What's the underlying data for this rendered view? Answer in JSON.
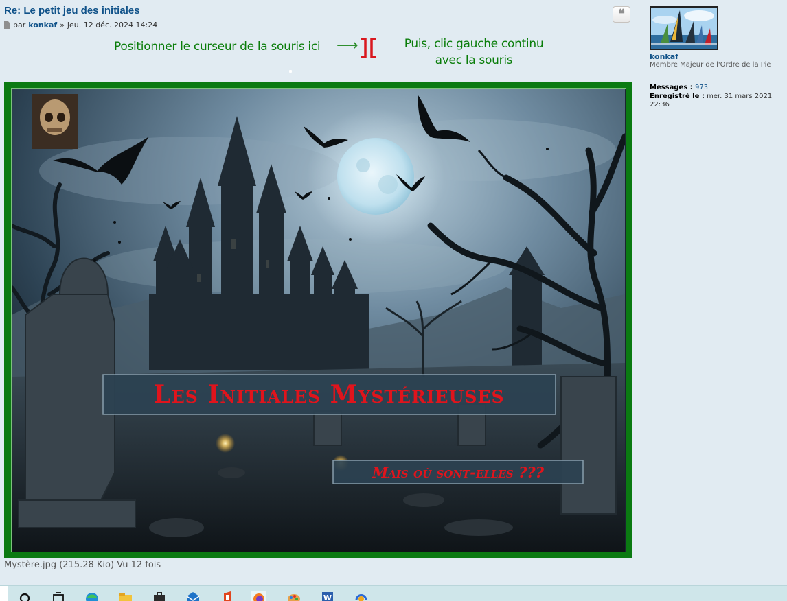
{
  "post": {
    "title": "Re: Le petit jeu des initiales",
    "by_label": "par",
    "author": "konkaf",
    "date_separator": "»",
    "date": "jeu. 12 déc. 2024 14:24",
    "quote_icon": "quote-icon",
    "quote_glyph": "❝"
  },
  "instructions": {
    "left_text": "Positionner le curseur de la souris ici",
    "arrow_glyph": "⟶",
    "right_line1": "Puis, clic gauche continu",
    "right_line2": "avec la souris"
  },
  "image": {
    "banner_title": "Les Initiales Mystérieuses",
    "banner_subtitle": "Mais où sont-elles ???",
    "caption": "Mystère.jpg (215.28 Kio) Vu 12 fois"
  },
  "profile": {
    "name": "konkaf",
    "rank": "Membre Majeur de l'Ordre de la Pie",
    "messages_label": "Messages :",
    "messages_value": "973",
    "registered_label": "Enregistré le :",
    "registered_value": "mer. 31 mars 2021 22:36"
  },
  "taskbar": {
    "icons": [
      "search-icon",
      "task-view-icon",
      "edge-icon",
      "file-explorer-icon",
      "store-icon",
      "mail-icon",
      "office-icon",
      "firefox-icon",
      "paint-icon",
      "word-icon",
      "headset-icon"
    ]
  },
  "colors": {
    "background": "#e1ebf2",
    "link": "#105289",
    "instruction_green": "#0a7d0a",
    "frame_green": "#0b7a12",
    "banner_red": "#e0141c",
    "cursor_red": "#d9181f"
  }
}
